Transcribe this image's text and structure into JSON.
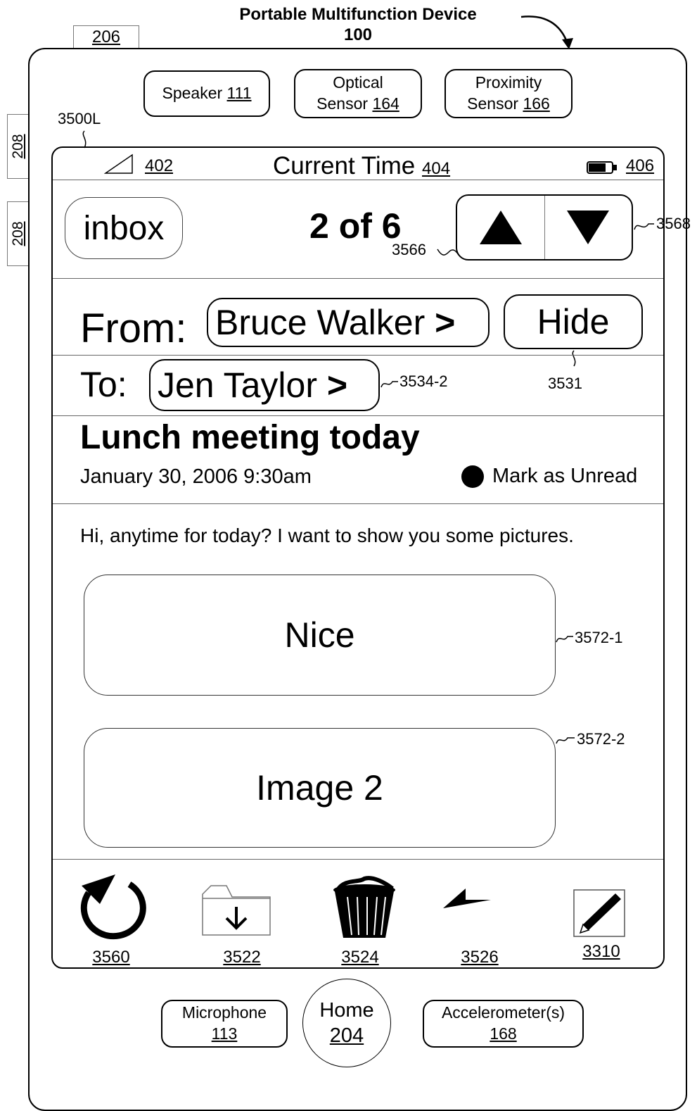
{
  "device": {
    "title": "Portable Multifunction Device",
    "ref": "100",
    "tab_206": "206",
    "side_button_top": "208",
    "side_button_bottom": "208",
    "screen_ref": "3500L"
  },
  "sensors": {
    "speaker": {
      "label": "Speaker",
      "ref": "111"
    },
    "optical": {
      "label_line1": "Optical",
      "label_line2": "Sensor",
      "ref": "164"
    },
    "proximity": {
      "label_line1": "Proximity",
      "label_line2": "Sensor",
      "ref": "166"
    }
  },
  "status_bar": {
    "signal_ref": "402",
    "time_label": "Current Time",
    "time_ref": "404",
    "battery_ref": "406"
  },
  "nav": {
    "inbox_label": "inbox",
    "position": "2 of 6",
    "position_ref": "3566",
    "arrows_ref": "3568"
  },
  "header": {
    "from_label": "From:",
    "from_name": "Bruce Walker",
    "hide_label": "Hide",
    "hide_ref": "3531",
    "to_label": "To:",
    "to_name": "Jen Taylor",
    "to_ref": "3534-2",
    "chevron": ">"
  },
  "message": {
    "subject": "Lunch meeting today",
    "date": "January 30, 2006 9:30am",
    "mark_unread": "Mark as Unread",
    "body": "Hi, anytime for today? I want to show you some pictures."
  },
  "attachments": [
    {
      "label": "Nice",
      "ref": "3572-1"
    },
    {
      "label": "Image 2",
      "ref": "3572-2"
    }
  ],
  "toolbar": {
    "refresh_ref": "3560",
    "move_ref": "3522",
    "trash_ref": "3524",
    "reply_ref": "3526",
    "compose_ref": "3310"
  },
  "bottom": {
    "microphone": {
      "label": "Microphone",
      "ref": "113"
    },
    "home": {
      "label": "Home",
      "ref": "204"
    },
    "accelerometer": {
      "label": "Accelerometer(s)",
      "ref": "168"
    }
  }
}
